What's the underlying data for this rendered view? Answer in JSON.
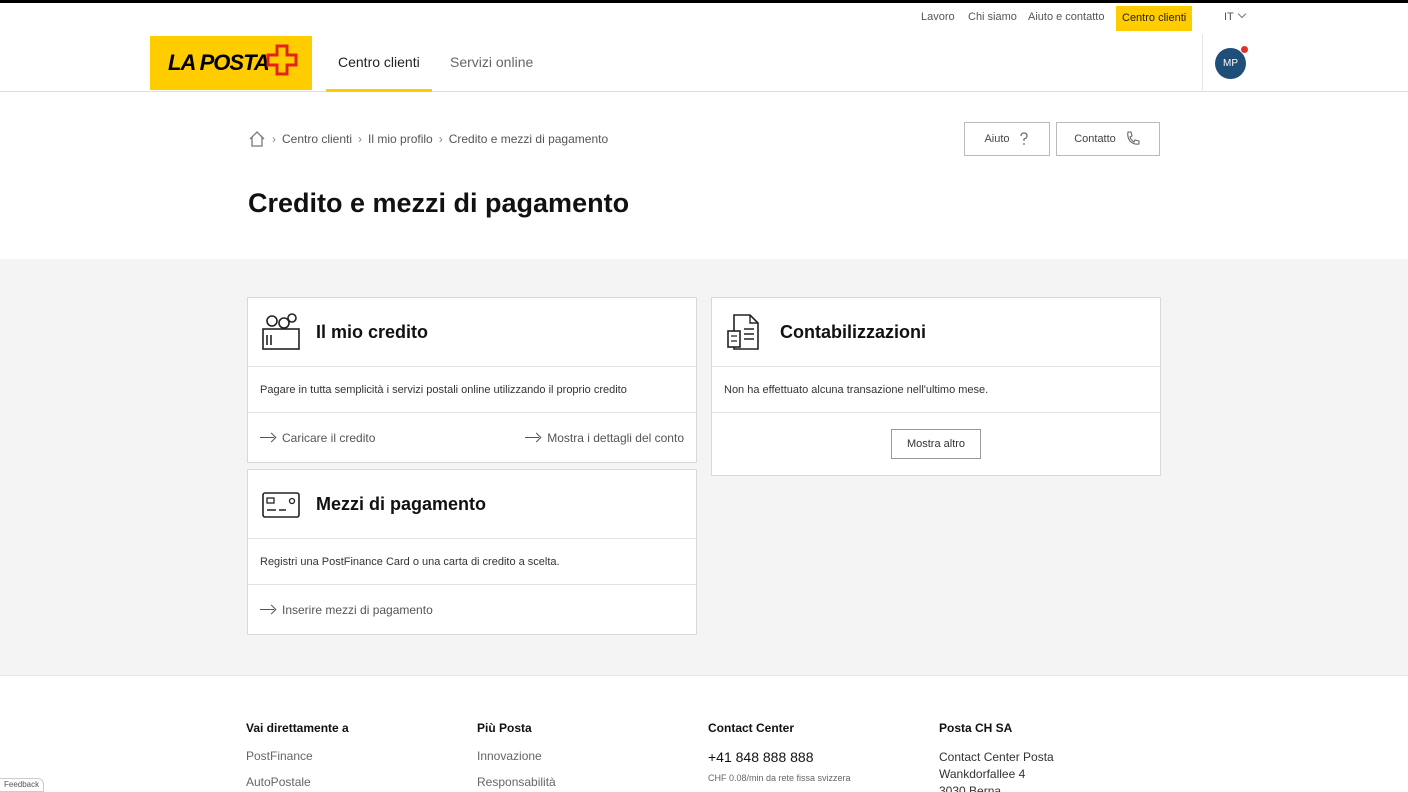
{
  "utility_bar": {
    "links": [
      "Lavoro",
      "Chi siamo",
      "Aiuto e contatto"
    ],
    "active_button": "Centro clienti",
    "language": "IT"
  },
  "nav": {
    "logo_text": "LA POSTA",
    "tabs": [
      "Centro clienti",
      "Servizi online"
    ],
    "avatar_initials": "MP"
  },
  "breadcrumb": {
    "items": [
      "Centro clienti",
      "Il mio profilo",
      "Credito e mezzi di pagamento"
    ]
  },
  "header_buttons": {
    "help": "Aiuto",
    "contact": "Contatto"
  },
  "page_title": "Credito e mezzi di pagamento",
  "cards": {
    "credit": {
      "title": "Il mio credito",
      "description": "Pagare in tutta semplicità i servizi postali online utilizzando il proprio credito",
      "link_left": "Caricare il credito",
      "link_right": "Mostra i dettagli del conto"
    },
    "payment": {
      "title": "Mezzi di pagamento",
      "description": "Registri una PostFinance Card o una carta di credito a scelta.",
      "link": "Inserire mezzi di pagamento"
    },
    "bookings": {
      "title": "Contabilizzazioni",
      "description": "Non ha effettuato alcuna transazione nell'ultimo mese.",
      "button": "Mostra altro"
    }
  },
  "footer": {
    "col1": {
      "heading": "Vai direttamente a",
      "items": [
        "PostFinance",
        "AutoPostale"
      ]
    },
    "col2": {
      "heading": "Più Posta",
      "items": [
        "Innovazione",
        "Responsabilità"
      ]
    },
    "col3": {
      "heading": "Contact Center",
      "phone": "+41 848 888 888",
      "note": "CHF 0.08/min da rete fissa svizzera"
    },
    "col4": {
      "heading": "Posta CH SA",
      "address": [
        "Contact Center Posta",
        "Wankdorfallee 4",
        "3030 Berna"
      ]
    }
  },
  "corner_tag": "Feedback",
  "colors": {
    "brand_yellow": "#ffcc00",
    "avatar_blue": "#1f4e79",
    "notification_red": "#e0342a",
    "page_gray": "#f4f4f4"
  },
  "icons": [
    "home-icon",
    "question-icon",
    "phone-icon",
    "coins-icon",
    "receipt-icon",
    "card-icon",
    "arrow-right-icon",
    "chevron-down-icon",
    "swiss-cross-icon"
  ]
}
